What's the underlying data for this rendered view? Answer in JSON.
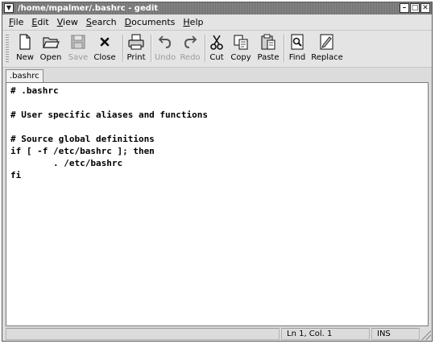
{
  "window": {
    "title": "/home/mpalmer/.bashrc - gedit"
  },
  "menubar": {
    "items": [
      {
        "label": "File",
        "accel": "F",
        "rest": "ile"
      },
      {
        "label": "Edit",
        "accel": "E",
        "rest": "dit"
      },
      {
        "label": "View",
        "accel": "V",
        "rest": "iew"
      },
      {
        "label": "Search",
        "accel": "S",
        "rest": "earch"
      },
      {
        "label": "Documents",
        "accel": "D",
        "rest": "ocuments"
      },
      {
        "label": "Help",
        "accel": "H",
        "rest": "elp"
      }
    ]
  },
  "toolbar": {
    "buttons": [
      {
        "label": "New",
        "icon": "new-document-icon",
        "enabled": true
      },
      {
        "label": "Open",
        "icon": "open-folder-icon",
        "enabled": true
      },
      {
        "label": "Save",
        "icon": "save-floppy-icon",
        "enabled": false
      },
      {
        "label": "Close",
        "icon": "close-x-icon",
        "enabled": true
      },
      {
        "label": "Print",
        "icon": "printer-icon",
        "enabled": true
      },
      {
        "label": "Undo",
        "icon": "undo-icon",
        "enabled": false
      },
      {
        "label": "Redo",
        "icon": "redo-icon",
        "enabled": false
      },
      {
        "label": "Cut",
        "icon": "scissors-icon",
        "enabled": true
      },
      {
        "label": "Copy",
        "icon": "copy-icon",
        "enabled": true
      },
      {
        "label": "Paste",
        "icon": "paste-clipboard-icon",
        "enabled": true
      },
      {
        "label": "Find",
        "icon": "find-icon",
        "enabled": true
      },
      {
        "label": "Replace",
        "icon": "replace-icon",
        "enabled": true
      }
    ]
  },
  "tabs": [
    {
      "label": ".bashrc",
      "active": true
    }
  ],
  "editor": {
    "lines": [
      "# .bashrc",
      "",
      "# User specific aliases and functions",
      "",
      "# Source global definitions",
      "if [ -f /etc/bashrc ]; then",
      "        . /etc/bashrc",
      "fi"
    ]
  },
  "statusbar": {
    "position": "Ln 1, Col. 1",
    "mode": "INS"
  }
}
